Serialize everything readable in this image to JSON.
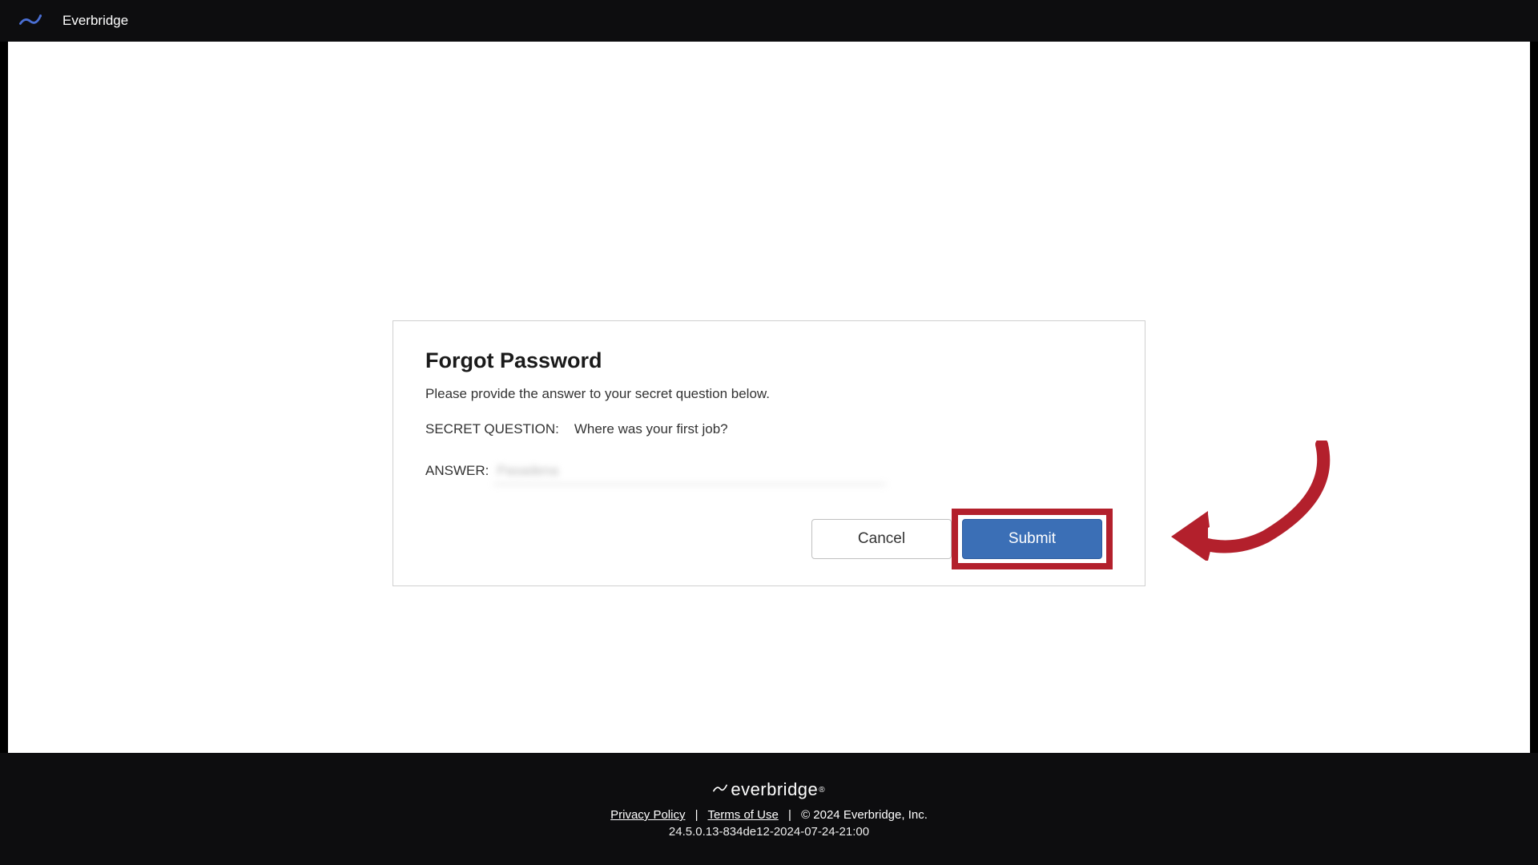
{
  "header": {
    "brand": "Everbridge"
  },
  "card": {
    "title": "Forgot Password",
    "subtitle": "Please provide the answer to your secret question below.",
    "questionLabel": "SECRET QUESTION:",
    "questionText": "Where was your first job?",
    "answerLabel": "ANSWER:",
    "answerValue": "Pasadena",
    "cancel": "Cancel",
    "submit": "Submit"
  },
  "footer": {
    "brand": "everbridge",
    "privacy": "Privacy Policy",
    "terms": "Terms of Use",
    "copyright": "©  2024 Everbridge, Inc.",
    "version": "24.5.0.13-834de12-2024-07-24-21:00"
  },
  "colors": {
    "highlight": "#b3202c",
    "primaryButton": "#3b6fb6"
  }
}
